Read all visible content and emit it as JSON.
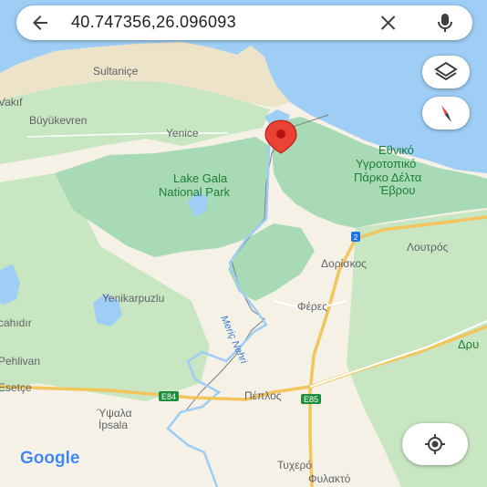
{
  "search": {
    "query": "40.747356,26.096093"
  },
  "attribution": "Google",
  "colors": {
    "water": "#9ecdf5",
    "park": "#a8dab5",
    "land": "#f5f1e6",
    "pin": "#ea4335",
    "road": "#f3c55d"
  },
  "icons": [
    "back-arrow-icon",
    "clear-icon",
    "microphone-icon",
    "layers-icon",
    "compass-icon",
    "my-location-icon",
    "location-pin-icon"
  ],
  "labels": {
    "sultanice": "Sultaniçe",
    "vakif": "Vakıf",
    "buyukevren": "Büyükevren",
    "yenice": "Yenice",
    "park_tr_1": "Lake Gala",
    "park_tr_2": "National Park",
    "park_gr_1": "Εθνικό",
    "park_gr_2": "Υγροτοπικό",
    "park_gr_3": "Πάρκο Δέλτα",
    "park_gr_4": "Έβρου",
    "loutros": "Λουτρός",
    "doriskos": "Δορίσκος",
    "yenikarpuzlu": "Yenikarpuzlu",
    "feres": "Φέρες",
    "cahidir": "cahıdır",
    "dru": "Δρυ",
    "pehlivan": "Pehlivan",
    "esetce": "Esetçe",
    "river": "Meriç Nehri",
    "peplos": "Πέπλος",
    "ipsala_gr": "Ύψαλα",
    "ipsala": "İpsala",
    "tyxero": "Τυχερό",
    "fylakto": "Φυλακτό",
    "e84": "E84",
    "e85": "E85",
    "route2": "2"
  }
}
